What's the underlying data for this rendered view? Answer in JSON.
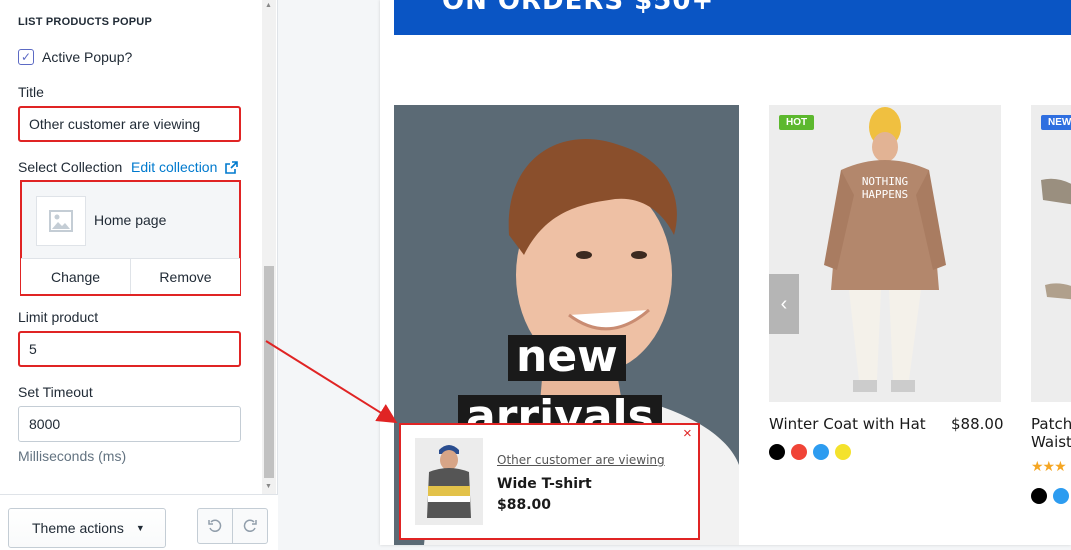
{
  "section_title": "LIST PRODUCTS POPUP",
  "active_popup": {
    "label": "Active Popup?",
    "checked": true
  },
  "title_field": {
    "label": "Title",
    "value": "Other customer are viewing"
  },
  "collection": {
    "label": "Select Collection",
    "edit_link": "Edit collection",
    "name": "Home page",
    "change_label": "Change",
    "remove_label": "Remove"
  },
  "limit_field": {
    "label": "Limit product",
    "value": "5"
  },
  "timeout_field": {
    "label": "Set Timeout",
    "value": "8000",
    "hint": "Milliseconds (ms)"
  },
  "bottom_bar": {
    "theme_actions": "Theme actions"
  },
  "preview": {
    "promo_text": "ON ORDERS $50+",
    "hero_words": [
      "new",
      "arrivals"
    ],
    "products": [
      {
        "badge": "HOT",
        "badge_color": "#5cb82e",
        "name": "Winter Coat with Hat",
        "price": "$88.00",
        "swatches": [
          "#000000",
          "#f04437",
          "#2d9cf0",
          "#f4e22c"
        ]
      },
      {
        "badge": "NEW",
        "badge_color": "#2f6fe0",
        "name": "Patch Waist",
        "price": "",
        "rating_stars": "★★★",
        "swatches": [
          "#000000",
          "#2d9cf0"
        ]
      }
    ],
    "popup": {
      "title": "Other customer are viewing",
      "product_name": "Wide T-shirt",
      "price": "$88.00",
      "close_icon": "×"
    }
  },
  "colors": {
    "accent": "#5c6ac4",
    "link": "#007ace",
    "highlight": "#e02424",
    "promo": "#0a55c4"
  }
}
